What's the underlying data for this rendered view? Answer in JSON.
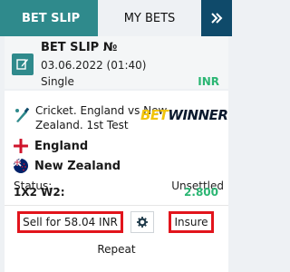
{
  "tabs": {
    "bet_slip": "BET SLIP",
    "my_bets": "MY BETS",
    "next_icon": "double-chevron-right-icon"
  },
  "header": {
    "title": "BET SLIP №",
    "date": "03.06.2022 (01:40)",
    "type": "Single",
    "currency": "INR",
    "edit_icon": "edit-icon"
  },
  "event": {
    "sport_icon": "cricket-bat-icon",
    "name": "Cricket. England vs New Zealand. 1st Test",
    "brand_bet": "BET",
    "brand_winner": "WINNER"
  },
  "teams": [
    {
      "name": "England",
      "flag": "england-flag-icon"
    },
    {
      "name": "New Zealand",
      "flag": "new-zealand-flag-icon"
    }
  ],
  "status": {
    "label": "Status:",
    "value": "Unsettled"
  },
  "odds": {
    "label": "1X2 W2:",
    "value": "2.800"
  },
  "actions": {
    "sell": "Sell for 58.04 INR",
    "settings_icon": "gear-icon",
    "insure": "Insure",
    "repeat": "Repeat"
  },
  "colors": {
    "primary_teal": "#2f8a8c",
    "dark_navy": "#0f4a6a",
    "green_value": "#2bb673",
    "highlight_red": "#e2141c",
    "brand_yellow": "#f2c40a"
  }
}
